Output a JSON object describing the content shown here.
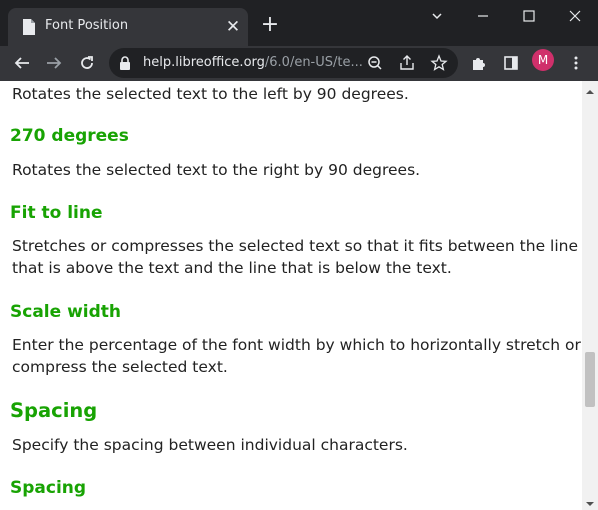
{
  "browser": {
    "tab_title": "Font Position",
    "url_host": "help.libreoffice.org",
    "url_path": "/6.0/en-US/te...",
    "profile_initial": "M",
    "colors": {
      "profile": "#d0306b",
      "heading": "#18a303"
    }
  },
  "page": {
    "para_90_left": "Rotates the selected text to the left by 90 degrees.",
    "h_270": "270 degrees",
    "para_270": "Rotates the selected text to the right by 90 degrees.",
    "h_fit": "Fit to line",
    "para_fit_1": "Stretches or compresses the selected text so that it fits between the line",
    "para_fit_2": "that is above the text and the line that is below the text.",
    "h_scale": "Scale width",
    "para_scale_1": "Enter the percentage of the font width by which to horizontally stretch or",
    "para_scale_2": "compress the selected text.",
    "h_spacing": "Spacing",
    "para_spacing": "Specify the spacing between individual characters.",
    "h_spacing_sub": "Spacing"
  }
}
